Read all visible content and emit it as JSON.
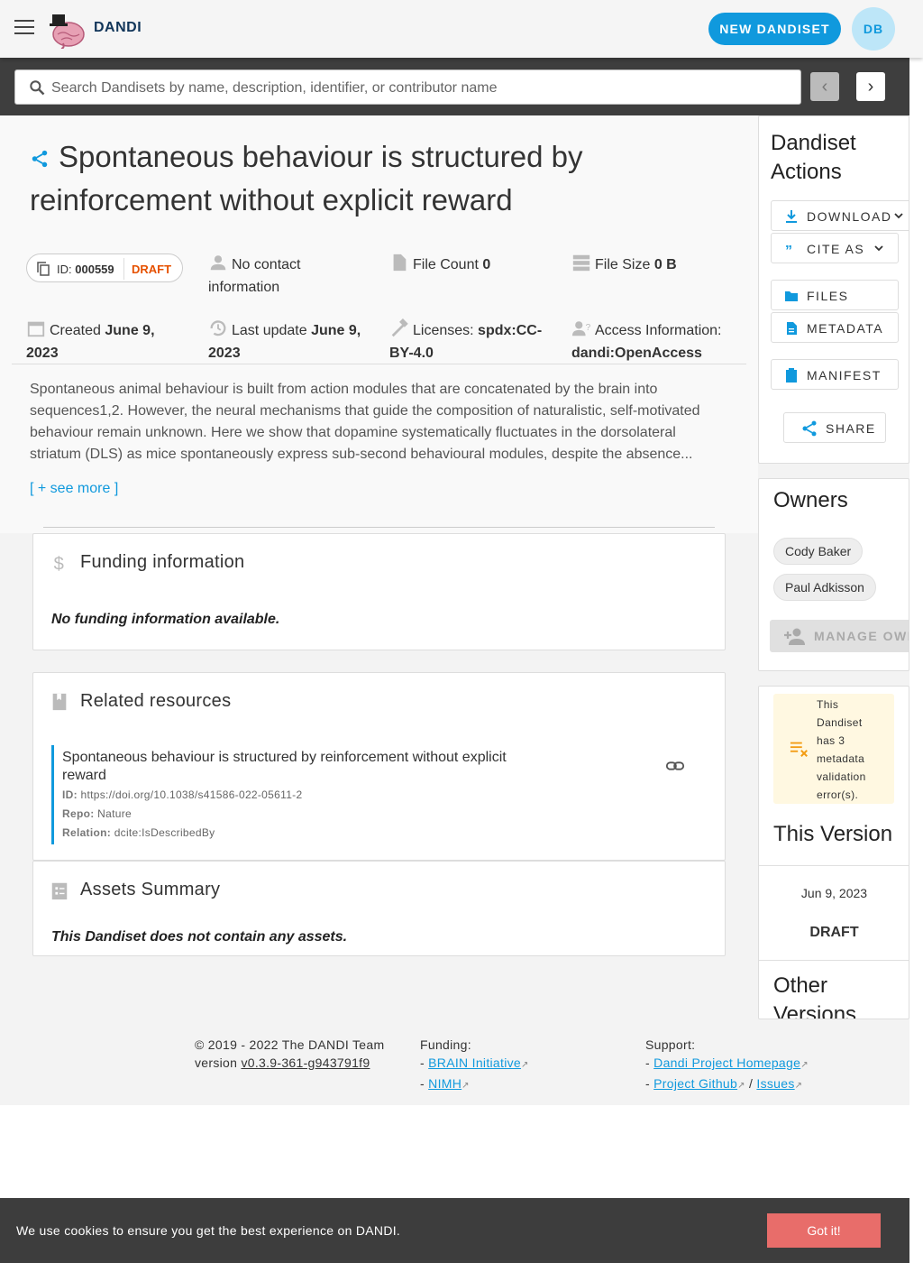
{
  "app": {
    "brand": "DANDI",
    "new_dandiset_label": "NEW DANDISET",
    "avatar_initials": "DB"
  },
  "search": {
    "placeholder": "Search Dandisets by name, description, identifier, or contributor name"
  },
  "dandiset": {
    "title": "Spontaneous behaviour is structured by reinforcement without explicit reward",
    "id_label": "ID:",
    "id": "000559",
    "status": "DRAFT",
    "contact": "No contact information",
    "file_count_label": "File Count",
    "file_count": "0",
    "file_size_label": "File Size",
    "file_size": "0 B",
    "created_label": "Created",
    "created": "June 9, 2023",
    "updated_label": "Last update",
    "updated": "June 9, 2023",
    "licenses_label": "Licenses:",
    "licenses": "spdx:CC-BY-4.0",
    "access_label": "Access Information:",
    "access": "dandi:OpenAccess",
    "description": "Spontaneous animal behaviour is built from action modules that are concatenated by the brain into sequences1,2. However, the neural mechanisms that guide the composition of naturalistic, self-motivated behaviour remain unknown. Here we show that dopamine systematically fluctuates in the dorsolateral striatum (DLS) as mice spontaneously express sub-second behavioural modules, despite the absence...",
    "see_more": "[ + see more ]"
  },
  "funding": {
    "title": "Funding information",
    "empty": "No funding information available."
  },
  "related": {
    "title": "Related resources",
    "items": [
      {
        "title": "Spontaneous behaviour is structured by reinforcement without explicit reward",
        "id_label": "ID:",
        "id": "https://doi.org/10.1038/s41586-022-05611-2",
        "repo_label": "Repo:",
        "repo": "Nature",
        "relation_label": "Relation:",
        "relation": "dcite:IsDescribedBy"
      }
    ]
  },
  "assets": {
    "title": "Assets Summary",
    "empty": "This Dandiset does not contain any assets."
  },
  "actions": {
    "title_line1": "Dandiset",
    "title_line2": "Actions",
    "download": "DOWNLOAD",
    "cite": "CITE AS",
    "files": "FILES",
    "metadata": "METADATA",
    "manifest": "MANIFEST",
    "share": "SHARE"
  },
  "owners": {
    "title": "Owners",
    "list": [
      "Cody Baker",
      "Paul Adkisson"
    ],
    "manage": "MANAGE OWNERS"
  },
  "version": {
    "warning": "This Dandiset has 3 metadata validation error(s).",
    "title": "This Version",
    "date": "Jun 9, 2023",
    "name": "DRAFT",
    "other_line1": "Other",
    "other_line2": "Versions"
  },
  "footer": {
    "copyright": "© 2019 - 2022 The DANDI Team",
    "version_prefix": "version",
    "version": "v0.3.9-361-g943791f9",
    "funding_label": "Funding:",
    "funding_links": [
      "BRAIN Initiative",
      "NIMH"
    ],
    "support_label": "Support:",
    "support_home": "Dandi Project Homepage",
    "support_github": "Project Github",
    "support_sep": "/",
    "support_issues": "Issues",
    "dash": "-"
  },
  "cookie": {
    "text": "We use cookies to ensure you get the best experience on DANDI.",
    "button": "Got it!"
  },
  "colors": {
    "accent": "#1099dd",
    "draft": "#e65100",
    "warning_bg": "#fff8e1",
    "warning_icon": "#f39c12",
    "cookie_button": "#e86d6a"
  }
}
